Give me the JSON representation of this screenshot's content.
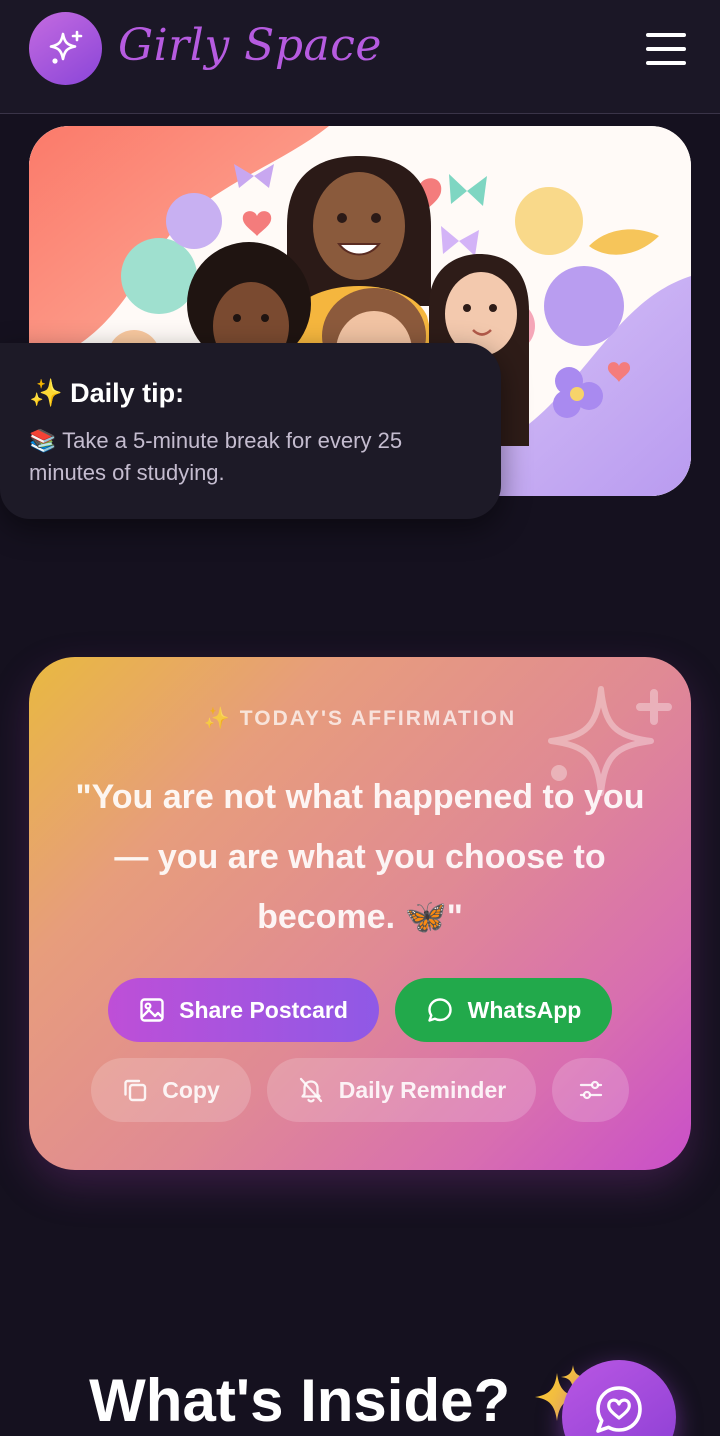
{
  "header": {
    "brand": "Girly Space",
    "logo_icon": "sparkles-icon",
    "menu_icon": "hamburger-menu-icon"
  },
  "hero": {
    "image": "illustration of smiling girls among flowers and butterflies"
  },
  "tip": {
    "title": "✨ Daily tip:",
    "text": "📚 Take a 5-minute break for every 25 minutes of studying."
  },
  "affirmation": {
    "label": "✨ TODAY'S AFFIRMATION",
    "quote": "\"You are not what happened to you — you are what you choose to become. 🦋\"",
    "share_label": "Share Postcard",
    "whatsapp_label": "WhatsApp",
    "copy_label": "Copy",
    "reminder_label": "Daily Reminder"
  },
  "section": {
    "title": "What's Inside?"
  },
  "colors": {
    "background": "#15111f",
    "brand": "#b65be0",
    "whatsapp": "#22a94b",
    "share": "#be4fd7"
  }
}
